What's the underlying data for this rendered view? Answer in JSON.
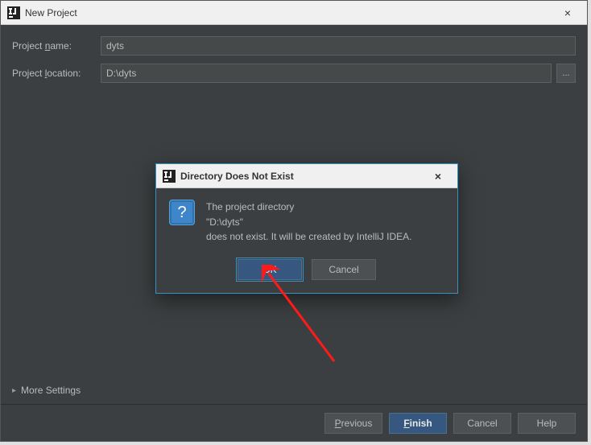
{
  "window": {
    "title": "New Project",
    "close": "×"
  },
  "form": {
    "name_label_pre": "Project ",
    "name_label_ul": "n",
    "name_label_post": "ame:",
    "name_value": "dyts",
    "location_label_pre": "Project ",
    "location_label_ul": "l",
    "location_label_post": "ocation:",
    "location_value": "D:\\dyts",
    "browse_label": "..."
  },
  "more_settings": {
    "label": "More Settings",
    "indicator": "▸"
  },
  "footer": {
    "previous_ul": "P",
    "previous_rest": "revious",
    "finish_ul": "F",
    "finish_rest": "inish",
    "cancel": "Cancel",
    "help": "Help"
  },
  "dialog": {
    "title": "Directory Does Not Exist",
    "close": "×",
    "line1": "The project directory",
    "line2": "\"D:\\dyts\"",
    "line3": "does not exist. It will be created by IntelliJ IDEA.",
    "question_mark": "?",
    "ok": "OK",
    "cancel": "Cancel"
  }
}
